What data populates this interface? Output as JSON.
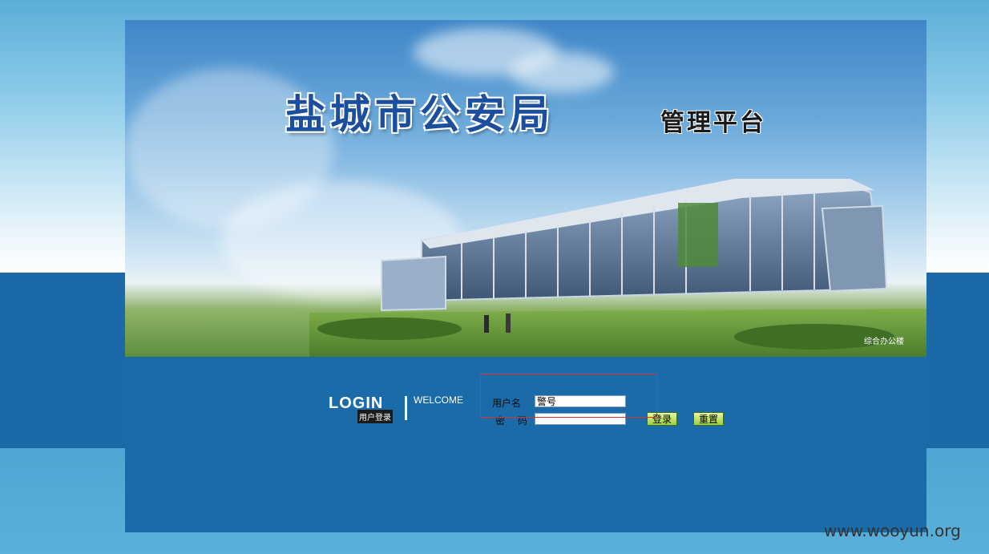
{
  "header": {
    "title_main": "盐城市公安局",
    "title_sub": "管理平台",
    "building_caption": "综合办公楼"
  },
  "login": {
    "logo_text": "LOGIN",
    "logo_subtitle": "用户登录",
    "welcome": "WELCOME",
    "username_label": "用户名",
    "username_value": "警号",
    "password_label": "密 码",
    "password_value": "",
    "login_button": "登录",
    "reset_button": "重置"
  },
  "watermark": "www.wooyun.org",
  "colors": {
    "frame_blue": "#1a6ba8",
    "button_green": "#9ccf3c",
    "highlight_red": "#d6322e"
  }
}
